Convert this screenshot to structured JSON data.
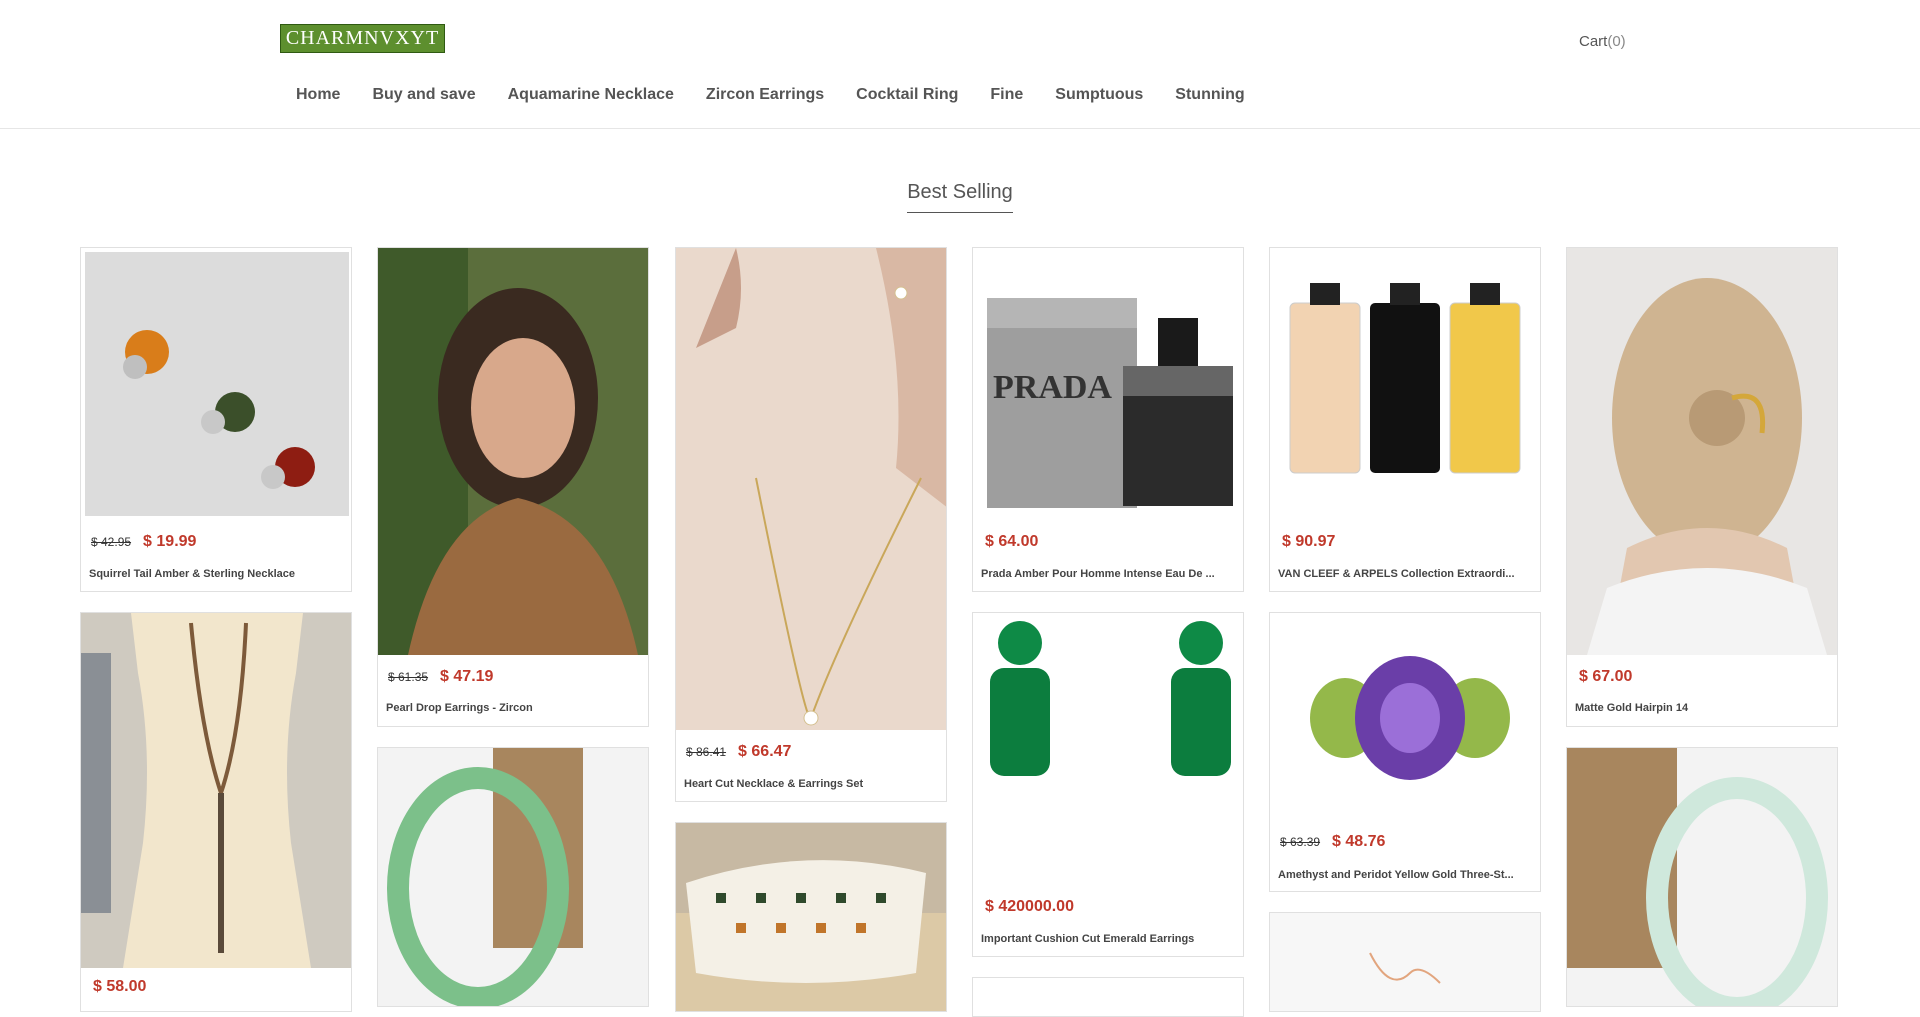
{
  "header": {
    "logo_text": "CHARMNVXYT",
    "cart_label": "Cart",
    "cart_count": "(0)",
    "nav": [
      "Home",
      "Buy and save",
      "Aquamarine Necklace",
      "Zircon Earrings",
      "Cocktail Ring",
      "Fine",
      "Sumptuous",
      "Stunning"
    ]
  },
  "section": {
    "title": "Best Selling"
  },
  "products": [
    {
      "name": "Squirrel Tail Amber & Sterling Necklace",
      "old_price": "$ 42.95",
      "price": "$ 19.99"
    },
    {
      "name": "",
      "old_price": "",
      "price": "$ 58.00"
    },
    {
      "name": "Pearl Drop Earrings - Zircon",
      "old_price": "$ 61.35",
      "price": "$ 47.19"
    },
    {
      "name": "",
      "old_price": "",
      "price": ""
    },
    {
      "name": "Heart Cut Necklace & Earrings Set",
      "old_price": "$ 86.41",
      "price": "$ 66.47"
    },
    {
      "name": "",
      "old_price": "",
      "price": ""
    },
    {
      "name": "Prada Amber Pour Homme Intense Eau De ...",
      "old_price": "",
      "price": "$ 64.00"
    },
    {
      "name": "Important Cushion Cut Emerald Earrings",
      "old_price": "",
      "price": "$ 420000.00"
    },
    {
      "name": "",
      "old_price": "",
      "price": ""
    },
    {
      "name": "VAN CLEEF & ARPELS Collection Extraordi...",
      "old_price": "",
      "price": "$ 90.97"
    },
    {
      "name": "Amethyst and Peridot Yellow Gold Three-St...",
      "old_price": "$ 63.39",
      "price": "$ 48.76"
    },
    {
      "name": "",
      "old_price": "",
      "price": ""
    },
    {
      "name": "Matte Gold Hairpin 14",
      "old_price": "",
      "price": "$ 67.00"
    },
    {
      "name": "",
      "old_price": "",
      "price": ""
    }
  ]
}
